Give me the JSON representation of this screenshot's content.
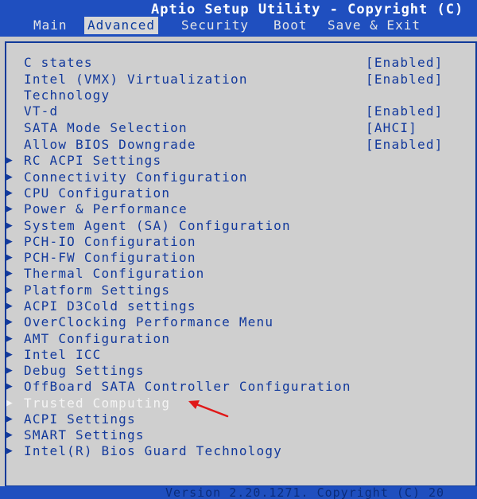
{
  "app": {
    "title": "Aptio Setup Utility - Copyright (C)"
  },
  "tabs": [
    {
      "label": "Main",
      "active": false
    },
    {
      "label": "Advanced",
      "active": true
    },
    {
      "label": "Security",
      "active": false
    },
    {
      "label": "Boot",
      "active": false
    },
    {
      "label": "Save & Exit",
      "active": false
    }
  ],
  "settings": [
    {
      "label": "C states",
      "value": "[Enabled]"
    },
    {
      "label": "Intel (VMX) Virtualization",
      "value": "[Enabled]"
    },
    {
      "label": "Technology",
      "value": ""
    },
    {
      "label": "VT-d",
      "value": "[Enabled]"
    },
    {
      "label": "SATA Mode Selection",
      "value": "[AHCI]"
    },
    {
      "label": "Allow BIOS Downgrade",
      "value": "[Enabled]"
    }
  ],
  "submenus": [
    "RC ACPI Settings",
    "Connectivity Configuration",
    "CPU Configuration",
    "Power & Performance",
    "System Agent (SA) Configuration",
    "PCH-IO Configuration",
    "PCH-FW Configuration",
    "Thermal Configuration",
    "Platform Settings",
    "ACPI D3Cold settings",
    "OverClocking Performance Menu",
    "AMT Configuration",
    "Intel ICC",
    "Debug Settings",
    "OffBoard SATA Controller Configuration",
    "Trusted Computing",
    "ACPI Settings",
    "SMART Settings",
    "Intel(R) Bios Guard Technology"
  ],
  "footer": {
    "text": "Version 2.20.1271. Copyright (C) 20"
  },
  "colors": {
    "header_bg": "#1f4fbf",
    "panel_bg": "#cfcfcf",
    "text_blue": "#12399c",
    "highlight_text": "#f4f4f4",
    "annotation_arrow": "#e01818"
  },
  "icons": {
    "submenu": "triangle-right-icon",
    "annotation": "red-arrow-icon"
  }
}
